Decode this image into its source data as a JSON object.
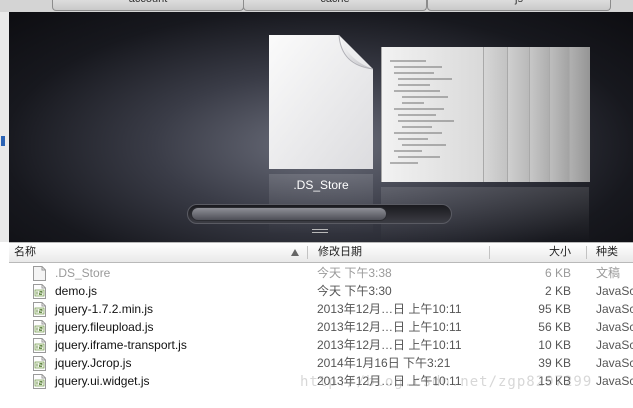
{
  "tabs": [
    "account",
    "cache",
    "js"
  ],
  "coverflow": {
    "selected_file": ".DS_Store"
  },
  "list": {
    "columns": {
      "name": "名称",
      "date": "修改日期",
      "size": "大小",
      "kind": "种类"
    },
    "rows": [
      {
        "name": ".DS_Store",
        "date": "今天 下午3:38",
        "size": "6 KB",
        "kind": "文稿",
        "icon": "document-icon",
        "dim": true
      },
      {
        "name": "demo.js",
        "date": "今天 下午3:30",
        "size": "2 KB",
        "kind": "JavaSc",
        "icon": "js-file-icon",
        "dim": false
      },
      {
        "name": "jquery-1.7.2.min.js",
        "date": "2013年12月…日 上午10:11",
        "size": "95 KB",
        "kind": "JavaSc",
        "icon": "js-file-icon",
        "dim": false
      },
      {
        "name": "jquery.fileupload.js",
        "date": "2013年12月…日 上午10:11",
        "size": "56 KB",
        "kind": "JavaSc",
        "icon": "js-file-icon",
        "dim": false
      },
      {
        "name": "jquery.iframe-transport.js",
        "date": "2013年12月…日 上午10:11",
        "size": "10 KB",
        "kind": "JavaSc",
        "icon": "js-file-icon",
        "dim": false
      },
      {
        "name": "jquery.Jcrop.js",
        "date": "2014年1月16日 下午3:21",
        "size": "39 KB",
        "kind": "JavaSc",
        "icon": "js-file-icon",
        "dim": false
      },
      {
        "name": "jquery.ui.widget.js",
        "date": "2013年12月…日 上午10:11",
        "size": "15 KB",
        "kind": "JavaSc",
        "icon": "js-file-icon",
        "dim": false
      }
    ]
  },
  "watermark": "http://blog.csdn.net/zgp8297299"
}
